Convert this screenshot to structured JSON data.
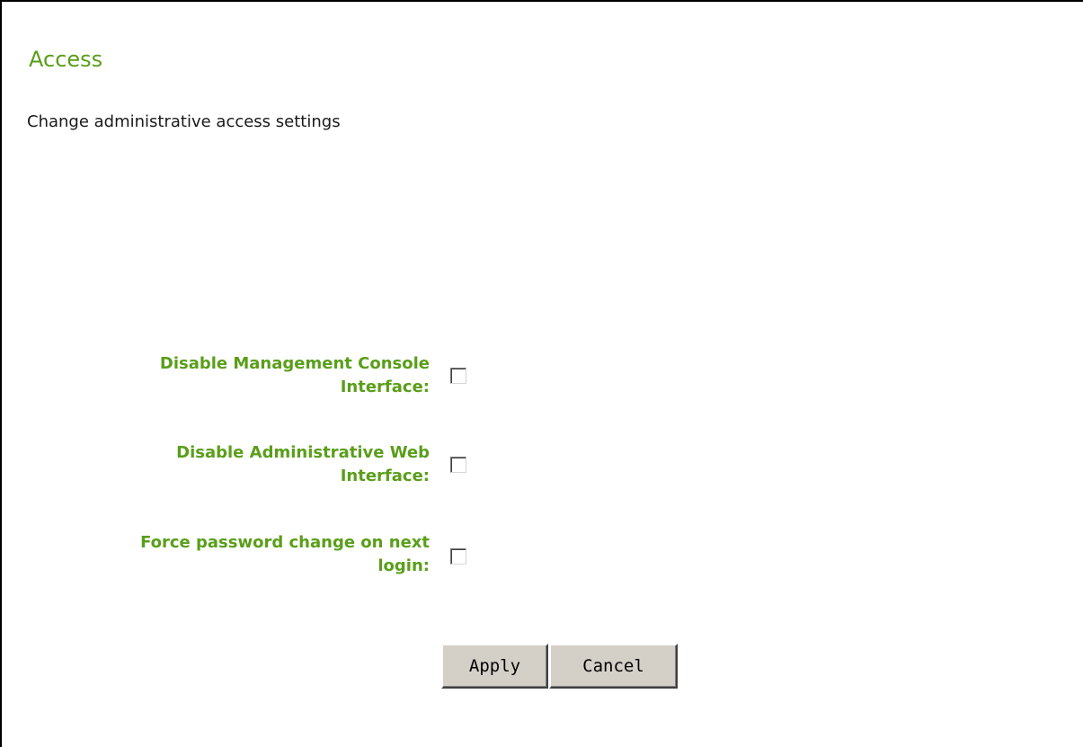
{
  "page": {
    "title": "Access",
    "subtitle": "Change administrative access settings"
  },
  "form": {
    "fields": [
      {
        "label_line1": "Disable Management Console",
        "label_line2": "Interface:",
        "checked": false
      },
      {
        "label_line1": "Disable Administrative Web",
        "label_line2": "Interface:",
        "checked": false
      },
      {
        "label_line1": "Force password change on next",
        "label_line2": "login:",
        "checked": false
      }
    ]
  },
  "buttons": {
    "apply_label": "Apply",
    "cancel_label": "Cancel"
  },
  "colors": {
    "accent_green": "#5a9e1a",
    "button_face": "#d4d0c8",
    "text": "#1a1a1a"
  }
}
